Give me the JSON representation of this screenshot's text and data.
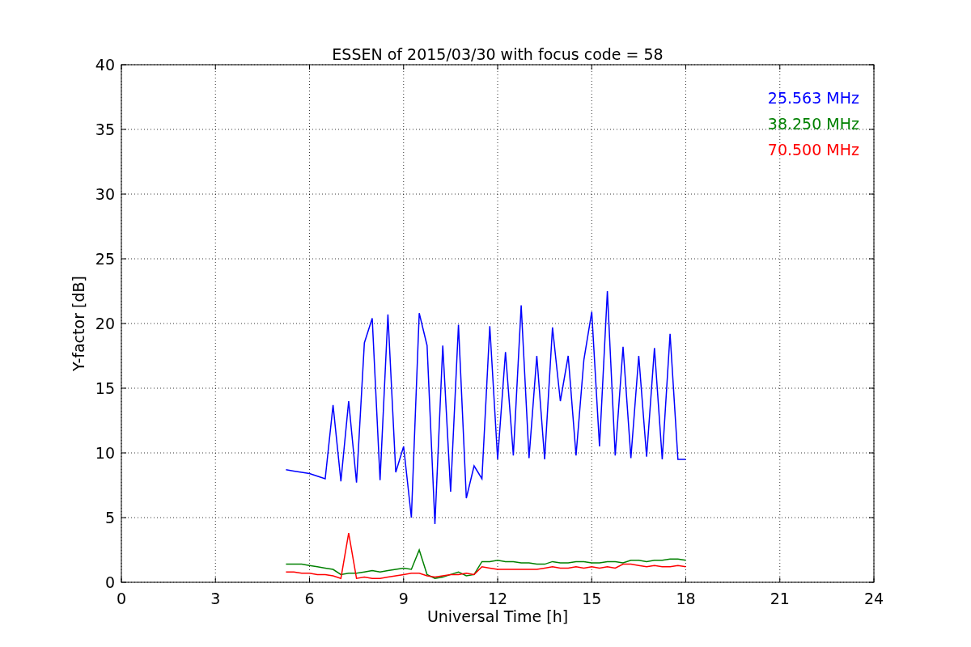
{
  "figure": {
    "chart_data": {
      "type": "line",
      "grid": true,
      "title": "ESSEN of 2015/03/30 with focus code = 58",
      "xlabel": "Universal Time [h]",
      "ylabel": "Y-factor [dB]",
      "xlim": [
        0,
        24
      ],
      "ylim": [
        0,
        40
      ],
      "xticks": [
        0,
        3,
        6,
        9,
        12,
        15,
        18,
        21,
        24
      ],
      "yticks": [
        0,
        5,
        10,
        15,
        20,
        25,
        30,
        35,
        40
      ],
      "x": [
        5.25,
        5.5,
        5.75,
        6,
        6.25,
        6.5,
        6.75,
        7,
        7.25,
        7.5,
        7.75,
        8,
        8.25,
        8.5,
        8.75,
        9,
        9.25,
        9.5,
        9.75,
        10,
        10.25,
        10.5,
        10.75,
        11,
        11.25,
        11.5,
        11.75,
        12,
        12.25,
        12.5,
        12.75,
        13,
        13.25,
        13.5,
        13.75,
        14,
        14.25,
        14.5,
        14.75,
        15,
        15.25,
        15.5,
        15.75,
        16,
        16.25,
        16.5,
        16.75,
        17,
        17.25,
        17.5,
        17.75,
        18
      ],
      "series": [
        {
          "name": "25.563 MHz",
          "color": "#0000ff",
          "values": [
            8.7,
            8.6,
            8.5,
            8.4,
            8.2,
            8.0,
            13.7,
            7.8,
            14.0,
            7.7,
            18.5,
            20.4,
            7.9,
            20.7,
            8.5,
            10.5,
            5.0,
            20.8,
            18.3,
            4.5,
            18.3,
            7.0,
            19.9,
            6.5,
            9.0,
            8.0,
            19.8,
            9.5,
            17.8,
            9.8,
            21.4,
            9.6,
            17.5,
            9.5,
            19.7,
            14.0,
            17.5,
            9.8,
            17.2,
            20.9,
            10.5,
            22.5,
            9.8,
            18.2,
            9.6,
            17.5,
            9.7,
            18.1,
            9.5,
            19.2,
            9.5,
            9.5
          ]
        },
        {
          "name": "38.250 MHz",
          "color": "#008000",
          "values": [
            1.4,
            1.4,
            1.4,
            1.3,
            1.2,
            1.1,
            1.0,
            0.6,
            0.7,
            0.7,
            0.8,
            0.9,
            0.8,
            0.9,
            1.0,
            1.1,
            1.0,
            2.5,
            0.6,
            0.3,
            0.4,
            0.6,
            0.8,
            0.5,
            0.6,
            1.6,
            1.6,
            1.7,
            1.6,
            1.6,
            1.5,
            1.5,
            1.4,
            1.4,
            1.6,
            1.5,
            1.5,
            1.6,
            1.6,
            1.5,
            1.5,
            1.6,
            1.6,
            1.5,
            1.7,
            1.7,
            1.6,
            1.7,
            1.7,
            1.8,
            1.8,
            1.7
          ]
        },
        {
          "name": "70.500 MHz",
          "color": "#ff0000",
          "values": [
            0.8,
            0.8,
            0.7,
            0.7,
            0.6,
            0.6,
            0.5,
            0.3,
            3.8,
            0.3,
            0.4,
            0.3,
            0.3,
            0.4,
            0.5,
            0.6,
            0.7,
            0.7,
            0.5,
            0.4,
            0.5,
            0.6,
            0.6,
            0.7,
            0.6,
            1.2,
            1.1,
            1.0,
            1.0,
            1.0,
            1.0,
            1.0,
            1.0,
            1.1,
            1.2,
            1.1,
            1.1,
            1.2,
            1.1,
            1.2,
            1.1,
            1.2,
            1.1,
            1.4,
            1.4,
            1.3,
            1.2,
            1.3,
            1.2,
            1.2,
            1.3,
            1.2
          ]
        }
      ]
    }
  }
}
